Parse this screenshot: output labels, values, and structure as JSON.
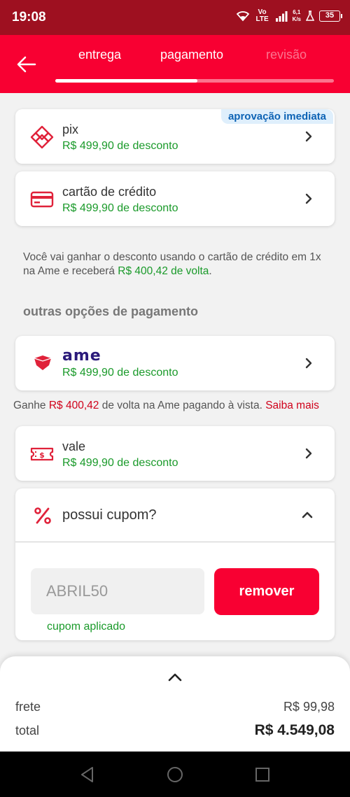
{
  "status": {
    "time": "19:08",
    "network": "Vo LTE",
    "speed_value": "6,1",
    "speed_unit": "K/s",
    "battery": "35"
  },
  "header": {
    "tabs": [
      "entrega",
      "pagamento",
      "revisão"
    ],
    "active_tab": "pagamento",
    "progress_percent": 51
  },
  "payment_options": [
    {
      "title": "pix",
      "discount": "R$ 499,90 de desconto",
      "badge": "aprovação imediata",
      "icon": "pix-icon"
    },
    {
      "title": "cartão de crédito",
      "discount": "R$ 499,90 de desconto",
      "icon": "credit-card-icon"
    }
  ],
  "info": {
    "text_before": "Você vai ganhar o desconto usando o cartão de crédito em 1x na Ame e receberá ",
    "cashback": "R$ 400,42 de volta",
    "text_after": "."
  },
  "other_options_title": "outras opções de pagamento",
  "ame_option": {
    "logo": "ame",
    "discount": "R$ 499,90 de desconto"
  },
  "ame_info": {
    "prefix": "Ganhe ",
    "amount": "R$ 400,42",
    "suffix": " de volta na Ame pagando à vista. ",
    "link": "Saiba mais"
  },
  "vale_option": {
    "title": "vale",
    "discount": "R$ 499,90 de desconto",
    "icon": "voucher-icon"
  },
  "coupon": {
    "title": "possui cupom?",
    "value": "ABRIL50",
    "button": "remover",
    "status": "cupom aplicado"
  },
  "summary": {
    "frete_label": "frete",
    "frete_value": "R$ 99,98",
    "total_label": "total",
    "total_value": "R$ 4.549,08"
  },
  "colors": {
    "brand_red": "#f80032",
    "status_bar": "#9e1020",
    "discount_green": "#1a9a2a",
    "badge_bg": "#dfeffc",
    "badge_text": "#0d63b5"
  }
}
